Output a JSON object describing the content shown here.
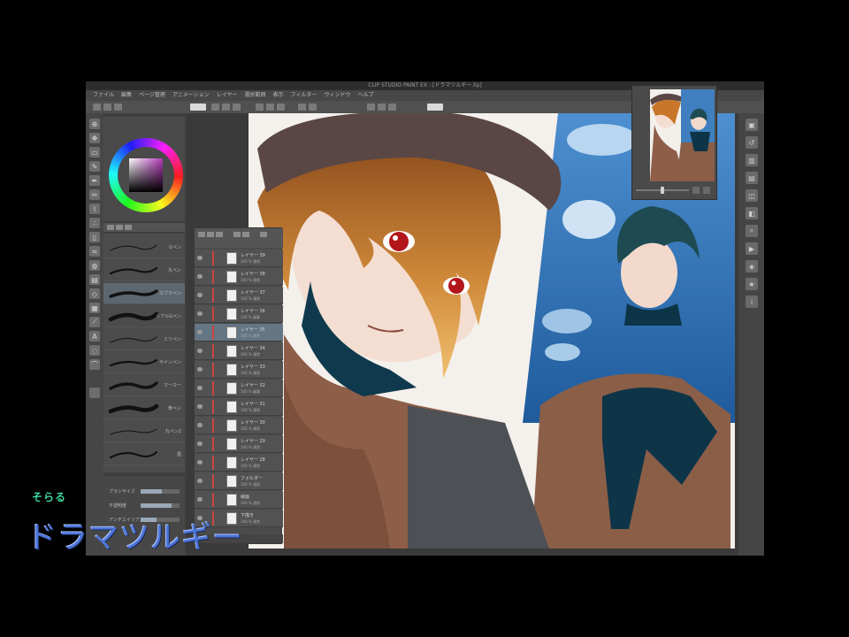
{
  "window": {
    "title": "CLIP STUDIO PAINT EX - [ドラマツルギー.lip]"
  },
  "menu": [
    "ファイル",
    "編集",
    "ページ管理",
    "アニメーション",
    "レイヤー",
    "選択範囲",
    "表示",
    "フィルター",
    "ウィンドウ",
    "ヘルプ"
  ],
  "brushes": [
    {
      "name": "Gペン"
    },
    {
      "name": "丸ペン"
    },
    {
      "name": "カブラペン"
    },
    {
      "name": "リアルGペン"
    },
    {
      "name": "ミリペン"
    },
    {
      "name": "サインペン"
    },
    {
      "name": "マーカー"
    },
    {
      "name": "筆ペン"
    },
    {
      "name": "丸ペン2"
    },
    {
      "name": "墨"
    }
  ],
  "properties": [
    {
      "label": "ブラシサイズ",
      "value": 0.55
    },
    {
      "label": "不透明度",
      "value": 0.8
    },
    {
      "label": "アンチエイリアス",
      "value": 0.4
    }
  ],
  "layers": [
    {
      "name": "レイヤー 39",
      "mode": "100 % 通常"
    },
    {
      "name": "レイヤー 38",
      "mode": "100 % 通常"
    },
    {
      "name": "レイヤー 37",
      "mode": "100 % 通常"
    },
    {
      "name": "レイヤー 36",
      "mode": "100 % 乗算"
    },
    {
      "name": "レイヤー 35",
      "mode": "100 % 通常"
    },
    {
      "name": "レイヤー 34",
      "mode": "100 % 通常"
    },
    {
      "name": "レイヤー 33",
      "mode": "100 % 通常"
    },
    {
      "name": "レイヤー 32",
      "mode": "100 % 乗算"
    },
    {
      "name": "レイヤー 31",
      "mode": "100 % 通常"
    },
    {
      "name": "レイヤー 30",
      "mode": "100 % 通常"
    },
    {
      "name": "レイヤー 29",
      "mode": "100 % 通常"
    },
    {
      "name": "レイヤー 28",
      "mode": "100 % 通常"
    },
    {
      "name": "フォルダー",
      "mode": "100 % 通過"
    },
    {
      "name": "線画",
      "mode": "100 % 通常"
    },
    {
      "name": "下描き",
      "mode": "100 % 通常"
    }
  ],
  "caption": {
    "small": "そらる",
    "title": "ドラマツルギー"
  },
  "colors": {
    "app_bg": "#3e3e3e",
    "caption_small": "#39d69b",
    "caption_title": "#4d74d8",
    "sky": "#2f6fb3",
    "coat": "#8e5f48",
    "scarf": "#0f3a4d",
    "hair_brown": "#c8762a",
    "hair_dark": "#1f4a52"
  }
}
